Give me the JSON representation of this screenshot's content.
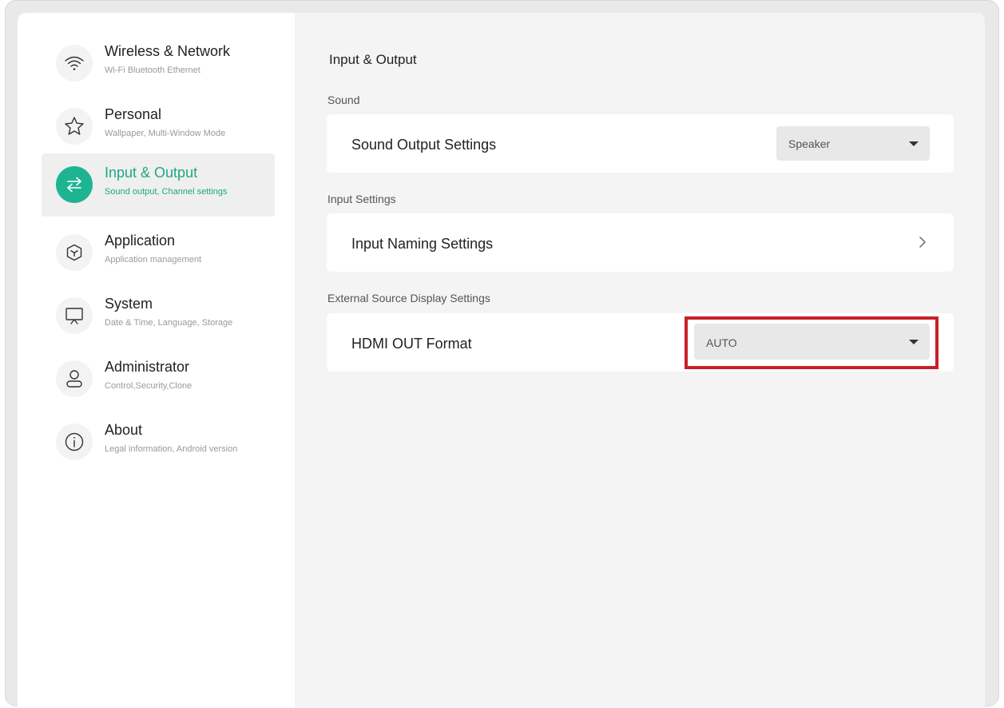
{
  "sidebar": {
    "items": [
      {
        "title": "Wireless & Network",
        "subtitle": "Wi-Fi Bluetooth Ethernet",
        "icon": "wifi-icon"
      },
      {
        "title": "Personal",
        "subtitle": "Wallpaper, Multi-Window Mode",
        "icon": "star-icon"
      },
      {
        "title": "Input & Output",
        "subtitle": "Sound output, Channel settings",
        "icon": "swap-arrows-icon"
      },
      {
        "title": "Application",
        "subtitle": "Application management",
        "icon": "cube-icon"
      },
      {
        "title": "System",
        "subtitle": "Date & Time, Language, Storage",
        "icon": "monitor-icon"
      },
      {
        "title": "Administrator",
        "subtitle": "Control,Security,Clone",
        "icon": "user-icon"
      },
      {
        "title": "About",
        "subtitle": "Legal information, Android version",
        "icon": "info-icon"
      }
    ],
    "active_index": 2
  },
  "main": {
    "title": "Input & Output",
    "sections": {
      "sound": {
        "label": "Sound",
        "row_label": "Sound Output Settings",
        "dropdown_value": "Speaker"
      },
      "input": {
        "label": "Input Settings",
        "row_label": "Input Naming Settings"
      },
      "external": {
        "label": "External Source Display Settings",
        "row_label": "HDMI OUT Format",
        "dropdown_value": "AUTO"
      }
    }
  },
  "colors": {
    "accent": "#1fb491",
    "highlight": "#c8202a"
  }
}
